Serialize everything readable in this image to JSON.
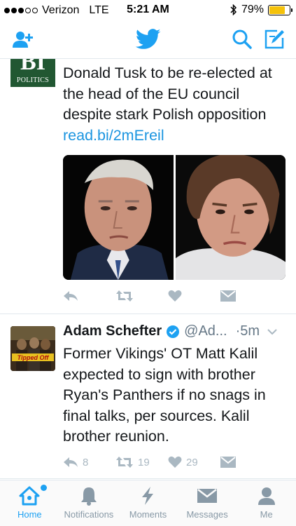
{
  "status_bar": {
    "carrier": "Verizon",
    "network": "LTE",
    "time": "5:21 AM",
    "battery_percent": "79%",
    "battery_level": 0.79
  },
  "tweet1": {
    "avatar": {
      "letters": "BI",
      "label": "POLITICS"
    },
    "text": "Donald Tusk to be re-elected at the head of the EU council despite stark Polish opposition ",
    "link": "read.bi/2mEreil"
  },
  "tweet2": {
    "name": "Adam Schefter",
    "handle": "@Ad...",
    "time": "·5m",
    "avatar_text": "Tipped Off",
    "text": "Former Vikings' OT Matt Kalil expected to sign with brother Ryan's Panthers if no snags in final talks, per sources. Kalil brother reunion.",
    "reply_count": "8",
    "retweet_count": "19",
    "like_count": "29"
  },
  "tab_bar": {
    "home": "Home",
    "notifications": "Notifications",
    "moments": "Moments",
    "messages": "Messages",
    "me": "Me"
  },
  "colors": {
    "accent": "#1da1f2",
    "link": "#1b95e0",
    "icon_gray": "#aab8c2",
    "bi_green": "#215732",
    "battery": "#f5c20a"
  },
  "icons": [
    "add-user-icon",
    "twitter-bird-icon",
    "search-icon",
    "compose-icon",
    "reply-icon",
    "retweet-icon",
    "like-icon",
    "direct-message-icon",
    "verified-icon",
    "chevron-down-icon",
    "home-icon",
    "notifications-icon",
    "moments-icon",
    "messages-icon",
    "me-icon",
    "bluetooth-icon"
  ]
}
